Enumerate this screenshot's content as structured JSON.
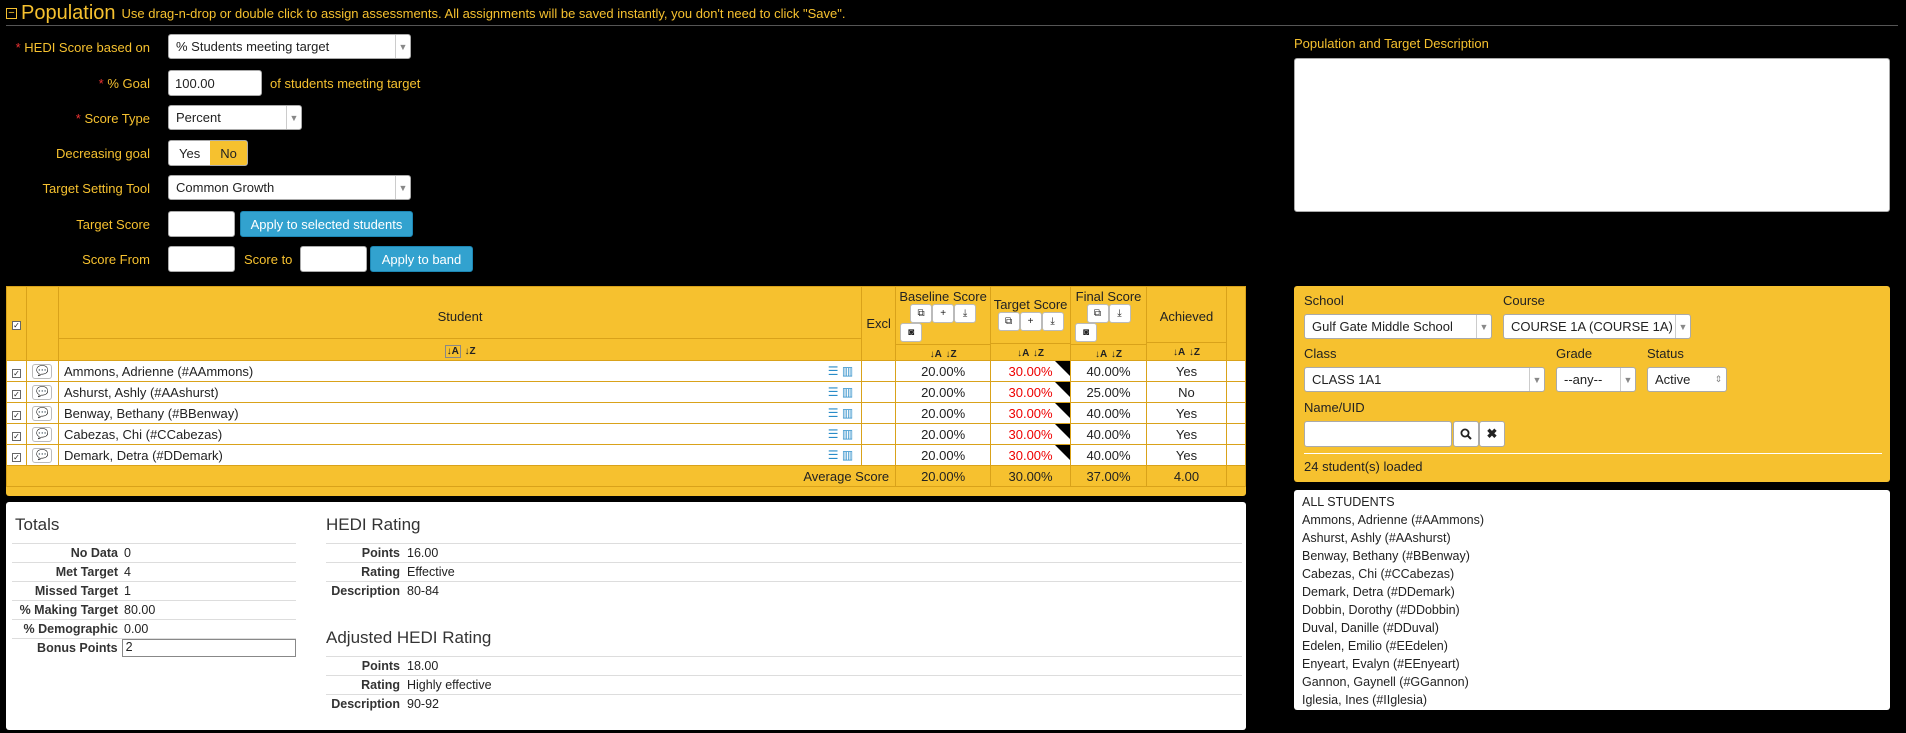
{
  "header": {
    "title": "Population",
    "hint": "Use drag-n-drop or double click to assign assessments. All assignments will be saved instantly, you don't need to click \"Save\"."
  },
  "form": {
    "hedi_label": "HEDI Score based on",
    "hedi_value": "% Students meeting target",
    "goal_label": "% Goal",
    "goal_value": "100.00",
    "goal_suffix": "of students meeting target",
    "score_type_label": "Score Type",
    "score_type_value": "Percent",
    "decreasing_label": "Decreasing goal",
    "decreasing_yes": "Yes",
    "decreasing_no": "No",
    "tool_label": "Target Setting Tool",
    "tool_value": "Common Growth",
    "target_score_label": "Target Score",
    "apply_selected": "Apply to selected students",
    "score_from_label": "Score From",
    "score_to_label": "Score to",
    "apply_band": "Apply to band"
  },
  "description": {
    "label": "Population and Target Description",
    "value": ""
  },
  "table": {
    "headers": {
      "student": "Student",
      "excl": "Excl",
      "baseline": "Baseline Score",
      "target": "Target Score",
      "final": "Final Score",
      "achieved": "Achieved"
    },
    "rows": [
      {
        "name": "Ammons, Adrienne (#AAmmons)",
        "baseline": "20.00%",
        "target": "30.00%",
        "final": "40.00%",
        "achieved": "Yes"
      },
      {
        "name": "Ashurst, Ashly (#AAshurst)",
        "baseline": "20.00%",
        "target": "30.00%",
        "final": "25.00%",
        "achieved": "No"
      },
      {
        "name": "Benway, Bethany (#BBenway)",
        "baseline": "20.00%",
        "target": "30.00%",
        "final": "40.00%",
        "achieved": "Yes"
      },
      {
        "name": "Cabezas, Chi (#CCabezas)",
        "baseline": "20.00%",
        "target": "30.00%",
        "final": "40.00%",
        "achieved": "Yes"
      },
      {
        "name": "Demark, Detra (#DDemark)",
        "baseline": "20.00%",
        "target": "30.00%",
        "final": "40.00%",
        "achieved": "Yes"
      }
    ],
    "average": {
      "label": "Average Score",
      "baseline": "20.00%",
      "target": "30.00%",
      "final": "37.00%",
      "achieved": "4.00"
    }
  },
  "totals": {
    "title": "Totals",
    "no_data_label": "No Data",
    "no_data": "0",
    "met_label": "Met Target",
    "met": "4",
    "missed_label": "Missed Target",
    "missed": "1",
    "making_label": "% Making Target",
    "making": "80.00",
    "demo_label": "% Demographic",
    "demo": "0.00",
    "bonus_label": "Bonus Points",
    "bonus": "2"
  },
  "hedi": {
    "title": "HEDI Rating",
    "points_label": "Points",
    "points": "16.00",
    "rating_label": "Rating",
    "rating": "Effective",
    "desc_label": "Description",
    "desc": "80-84"
  },
  "adjusted": {
    "title": "Adjusted HEDI Rating",
    "points_label": "Points",
    "points": "18.00",
    "rating_label": "Rating",
    "rating": "Highly effective",
    "desc_label": "Description",
    "desc": "90-92"
  },
  "filters": {
    "school_label": "School",
    "school": "Gulf Gate Middle School",
    "course_label": "Course",
    "course": "COURSE 1A (COURSE 1A)",
    "class_label": "Class",
    "class": "CLASS 1A1",
    "grade_label": "Grade",
    "grade": "--any--",
    "status_label": "Status",
    "status": "Active",
    "name_label": "Name/UID",
    "loaded": "24 student(s) loaded"
  },
  "student_list": [
    "ALL STUDENTS",
    "Ammons, Adrienne (#AAmmons)",
    "Ashurst, Ashly (#AAshurst)",
    "Benway, Bethany (#BBenway)",
    "Cabezas, Chi (#CCabezas)",
    "Demark, Detra (#DDemark)",
    "Dobbin, Dorothy (#DDobbin)",
    "Duval, Danille (#DDuval)",
    "Edelen, Emilio (#EEdelen)",
    "Enyeart, Evalyn (#EEnyeart)",
    "Gannon, Gaynell (#GGannon)",
    "Iglesia, Ines (#IIglesia)"
  ],
  "colors": {
    "accent": "#f6c12f",
    "button": "#32a2cf",
    "required": "#e33",
    "target_value": "#e00"
  }
}
